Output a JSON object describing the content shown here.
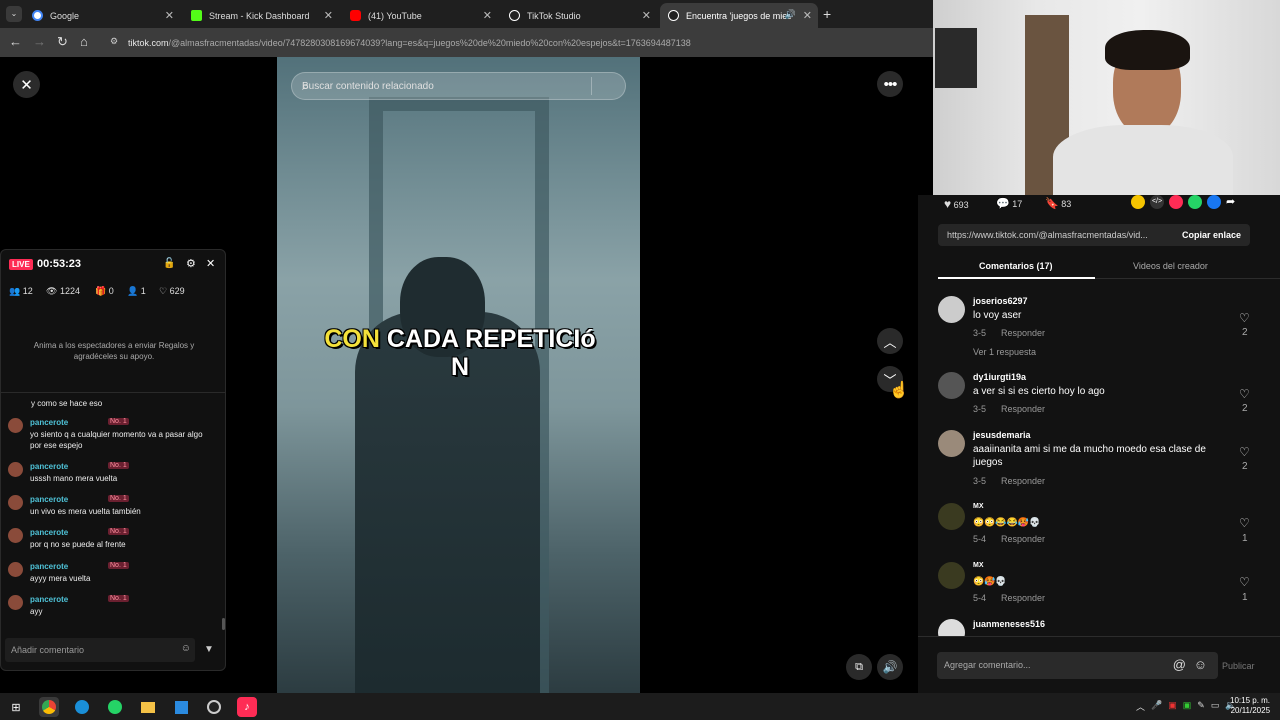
{
  "browser": {
    "tabs": [
      {
        "label": "Google",
        "color": "#4285f4"
      },
      {
        "label": "Stream - Kick Dashboard",
        "color": "#53fc18"
      },
      {
        "label": "(41) YouTube",
        "color": "#ff0000"
      },
      {
        "label": "TikTok Studio",
        "color": "#ffffff"
      },
      {
        "label": "Encuentra 'juegos de miedo...",
        "color": "#ffffff"
      }
    ],
    "url_host": "tiktok.com",
    "url_path": "/@almasfracmentadas/video/7478280308169674039?lang=es&q=juegos%20de%20miedo%20con%20espejos&t=1763694487138"
  },
  "video": {
    "search_placeholder": "Buscar contenido relacionado",
    "caption_yellow": "CON",
    "caption_white": "CADA REPETICIó",
    "caption_line2": "N"
  },
  "live": {
    "badge": "LIVE",
    "timer": "00:53:23",
    "stats": [
      "12",
      "1224",
      "0",
      "1",
      "629"
    ],
    "prompt": "Anima a los espectadores a enviar Regalos y agradéceles su apoyo.",
    "first_line": "y como se hace eso",
    "chat": [
      {
        "user": "pancerote",
        "badge": "No. 1",
        "text": "yo siento q a cualquier momento va a pasar algo por ese espejo"
      },
      {
        "user": "pancerote",
        "badge": "No. 1",
        "text": "usssh mano mera vuelta"
      },
      {
        "user": "pancerote",
        "badge": "No. 1",
        "text": "un vivo es mera vuelta también"
      },
      {
        "user": "pancerote",
        "badge": "No. 1",
        "text": "por q no se puede al frente"
      },
      {
        "user": "pancerote",
        "badge": "No. 1",
        "text": "ayyy mera vuelta"
      },
      {
        "user": "pancerote",
        "badge": "No. 1",
        "text": "ayy"
      }
    ],
    "input_placeholder": "Añadir comentario"
  },
  "actions": {
    "likes": "693",
    "comments": "17",
    "saves": "83",
    "link": "https://www.tiktok.com/@almasfracmentadas/vid...",
    "copy_label": "Copiar enlace"
  },
  "tabs": {
    "comments_label": "Comentarios (17)",
    "creator_label": "Videos del creador"
  },
  "comments": [
    {
      "user": "joserios6297",
      "text": "lo voy aser",
      "date": "3-5",
      "reply": "Responder",
      "likes": "2",
      "more": "Ver 1 respuesta"
    },
    {
      "user": "dy1iurgti19a",
      "text": "a ver si si es cierto hoy lo ago",
      "date": "3-5",
      "reply": "Responder",
      "likes": "2"
    },
    {
      "user": "jesusdemaria",
      "text": "aaaiinanita ami si me da mucho moedo esa clase de juegos",
      "date": "3-5",
      "reply": "Responder",
      "likes": "2"
    },
    {
      "user": "MX",
      "text": "😳😳😂😂🥵💀",
      "date": "5-4",
      "reply": "Responder",
      "likes": "1"
    },
    {
      "user": "MX",
      "text": "😳🥵💀",
      "date": "5-4",
      "reply": "Responder",
      "likes": "1"
    },
    {
      "user": "juanmeneses516",
      "text": "",
      "date": "",
      "reply": "",
      "likes": ""
    }
  ],
  "compose": {
    "placeholder": "Agregar comentario...",
    "publish": "Publicar"
  },
  "taskbar": {
    "time": "10:15 p. m.",
    "date": "20/11/2025"
  }
}
